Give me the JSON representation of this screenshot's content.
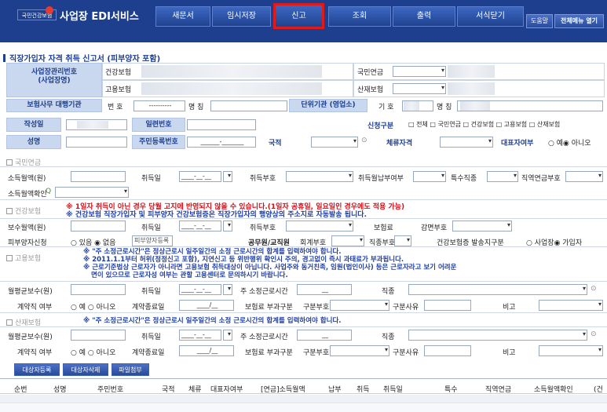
{
  "header": {
    "logo": "국민건강보험",
    "title": "사업장 EDI서비스",
    "nav": [
      "새문서",
      "임시저장",
      "신고",
      "조회",
      "출력",
      "서식닫기"
    ],
    "help": "도움말",
    "all_menu": "전체메뉴 열기"
  },
  "page_title": "직장가입자 자격 취득 신고서 (피부양자 포함)",
  "top": {
    "bizno_label": "사업장관리번호\n(사업장명)",
    "health": "건강보험",
    "employ": "고용보험",
    "pension": "국민연금",
    "accident": "산재보험",
    "agency_label": "보험사무 대행기관",
    "num_label": "번 호",
    "num_value": "----------",
    "name_label": "명 칭",
    "unit_label": "단위기관 (영업소)",
    "code_label": "기 호",
    "unit_name_label": "명 칭"
  },
  "meta": {
    "date_label": "작성일",
    "serial_label": "일련번호",
    "apply_label": "신청구분",
    "apply_options": [
      "전체",
      "국민연금",
      "건강보험",
      "고용보험",
      "산재보험"
    ],
    "name_label": "성명",
    "rrn_label": "주민등록번호",
    "rrn_value": "______-_______",
    "nation_label": "국적",
    "stay_label": "체류자격",
    "rep_label": "대표자여부",
    "rep_yes": "예",
    "rep_no": "아니오"
  },
  "pension": {
    "title": "국민연금",
    "income": "소득월액(원)",
    "acq_date": "취득일",
    "date_value": "____-__-__",
    "acq_code": "취득부호",
    "pay_wish": "취득월납부여부",
    "special": "특수직종",
    "job_code": "직역연금부호",
    "income_confirm": "소득월액확인"
  },
  "health": {
    "title": "건강보험",
    "warn1": "※ 1일자 취득이 아닌 경우 당월 고지에 반영되지 않을 수 있습니다.(1일자 공휴일, 일요일인 경우에도 적용 가능)",
    "warn2": "※ 건강보험 직장가입자 및 피부양자 건강보험증은 직장가입자의 행양상의 주소지로 자동발송 됩니다.",
    "pay": "보수월액(원)",
    "acq_date": "취득일",
    "acq_code": "취득부호",
    "premium": "보험료",
    "reduce": "감면부호",
    "dependent": "피부양자신청",
    "has": "있음",
    "none": "없음",
    "register": "피부양자등록",
    "civil": "공무원/교직원",
    "account": "회계부호",
    "job": "직종부호",
    "card": "건강보험증 발송지구분",
    "biz": "사업장",
    "member": "가입자"
  },
  "employment": {
    "title": "고용보험",
    "note1": "※ \"주 소정근로시간\"은 정상근로시 일주일간의 소정 근로시간의 합계를 입력하여야 합니다.",
    "note2": "※ 2011.1.1부터 허위(정정신고 포함), 지연신고 등 위반행위 확인시 주의, 경고없이 즉시 과태료가 부과됩니다.",
    "note3": "※ 근로기준법상 근로자가 아니라면 고용보험 취득대상이 아닙니다. 사업주와 동거친족, 임원(법인이사) 등은 근로자라고 보기 어려운",
    "note4": "면이 있으므로 근로자성 여부는 관할 고용센터로 문의하시기 바랍니다.",
    "wage": "월평균보수(원)",
    "acq_date": "취득일",
    "hours": "주 소정근로시간",
    "hours_value": "__",
    "job": "직종",
    "contract": "계약직 여부",
    "yes": "예",
    "no": "아니오",
    "end_date": "계약종료일",
    "end_value": "____/__",
    "levy": "보험료 부과구분",
    "code": "구분부호",
    "reason": "구분사유",
    "note": "비고"
  },
  "accident": {
    "title": "산재보험",
    "note1": "※ \"주 소정근로시간\"은 정상근로시 일주일간의 소정 근로시간의 합계를 입력하여야 합니다."
  },
  "buttons": [
    "대상자등록",
    "대상자삭제",
    "파일첨부"
  ],
  "table_headers": [
    "순번",
    "성명",
    "주민번호",
    "국적",
    "체류",
    "대표자여부",
    "[연금]소득월액",
    "납부",
    "취득",
    "취득일",
    "특수",
    "직역연금",
    "소득월액확인",
    "(건"
  ]
}
